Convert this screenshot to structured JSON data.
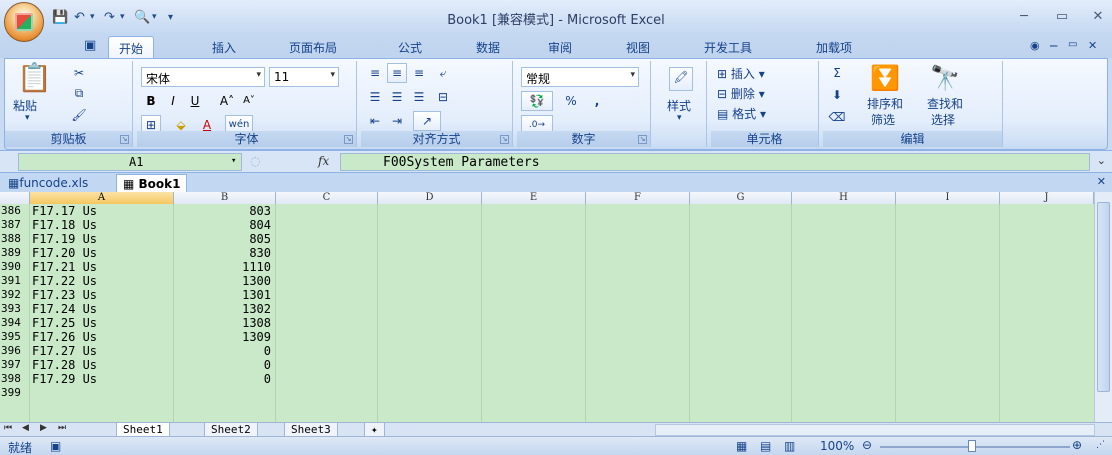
{
  "window": {
    "title": "Book1  [兼容模式] - Microsoft Excel"
  },
  "tabs": [
    "开始",
    "插入",
    "页面布局",
    "公式",
    "数据",
    "审阅",
    "视图",
    "开发工具",
    "加载项"
  ],
  "ribbon": {
    "clipboard": {
      "label": "剪贴板",
      "paste": "粘贴"
    },
    "font": {
      "label": "字体",
      "name": "宋体",
      "size": "11"
    },
    "alignment": {
      "label": "对齐方式"
    },
    "number": {
      "label": "数字",
      "format": "常规",
      "percent": "%",
      "comma": ","
    },
    "styles": {
      "label": "样式"
    },
    "cells": {
      "label": "单元格",
      "insert": "插入",
      "delete": "删除",
      "format": "格式"
    },
    "editing": {
      "label": "编辑",
      "sort": "排序和",
      "sort2": "筛选",
      "find": "查找和",
      "find2": "选择"
    }
  },
  "formula_bar": {
    "name_box": "A1",
    "fx": "fx",
    "content": "F00System Parameters"
  },
  "workbooks": [
    "funcode.xls",
    "Book1"
  ],
  "columns": [
    "A",
    "B",
    "C",
    "D",
    "E",
    "F",
    "G",
    "H",
    "I",
    "J"
  ],
  "rows": [
    {
      "n": "386",
      "a": "F17.17 Us",
      "b": "803"
    },
    {
      "n": "387",
      "a": "F17.18 Us",
      "b": "804"
    },
    {
      "n": "388",
      "a": "F17.19 Us",
      "b": "805"
    },
    {
      "n": "389",
      "a": "F17.20 Us",
      "b": "830"
    },
    {
      "n": "390",
      "a": "F17.21 Us",
      "b": "1110"
    },
    {
      "n": "391",
      "a": "F17.22 Us",
      "b": "1300"
    },
    {
      "n": "392",
      "a": "F17.23 Us",
      "b": "1301"
    },
    {
      "n": "393",
      "a": "F17.24 Us",
      "b": "1302"
    },
    {
      "n": "394",
      "a": "F17.25 Us",
      "b": "1308"
    },
    {
      "n": "395",
      "a": "F17.26 Us",
      "b": "1309"
    },
    {
      "n": "396",
      "a": "F17.27 Us",
      "b": "0"
    },
    {
      "n": "397",
      "a": "F17.28 Us",
      "b": "0"
    },
    {
      "n": "398",
      "a": "F17.29 Us",
      "b": "0"
    },
    {
      "n": "399",
      "a": "",
      "b": ""
    }
  ],
  "sheets": [
    "Sheet1",
    "Sheet2",
    "Sheet3"
  ],
  "status": {
    "ready": "就绪",
    "zoom": "100%"
  }
}
